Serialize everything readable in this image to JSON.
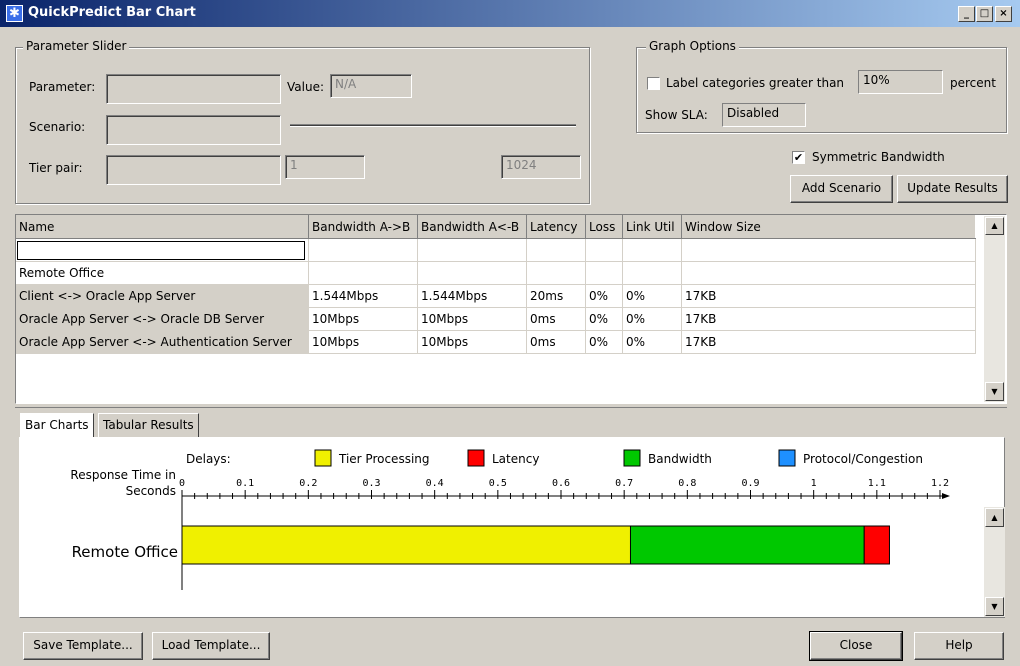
{
  "window": {
    "title": "QuickPredict Bar Chart"
  },
  "parameter_slider": {
    "legend": "Parameter Slider",
    "parameter_label": "Parameter:",
    "value_label": "Value:",
    "value": "N/A",
    "scenario_label": "Scenario:",
    "tier_pair_label": "Tier pair:",
    "range_min": "1",
    "range_max": "1024"
  },
  "graph_options": {
    "legend": "Graph Options",
    "label_categories_text": "Label categories greater than",
    "label_threshold": "10%",
    "percent_text": "percent",
    "show_sla_label": "Show SLA:",
    "show_sla_value": "Disabled"
  },
  "symmetric_bandwidth": {
    "label": "Symmetric Bandwidth",
    "checked": true
  },
  "buttons": {
    "add_scenario": "Add Scenario",
    "update_results": "Update Results",
    "save_template": "Save Template...",
    "load_template": "Load Template...",
    "close": "Close",
    "help": "Help"
  },
  "table": {
    "columns": [
      "Name",
      "Bandwidth A->B",
      "Bandwidth A<-B",
      "Latency",
      "Loss",
      "Link Util",
      "Window Size"
    ],
    "group_label": "Remote Office",
    "rows": [
      [
        "Client <-> Oracle App Server",
        "1.544Mbps",
        "1.544Mbps",
        "20ms",
        "0%",
        "0%",
        "17KB"
      ],
      [
        "Oracle App Server <-> Oracle DB Server",
        "10Mbps",
        "10Mbps",
        "0ms",
        "0%",
        "0%",
        "17KB"
      ],
      [
        "Oracle App Server <-> Authentication Server",
        "10Mbps",
        "10Mbps",
        "0ms",
        "0%",
        "0%",
        "17KB"
      ]
    ]
  },
  "tabs": [
    "Bar Charts",
    "Tabular Results"
  ],
  "chart_data": {
    "type": "bar",
    "orientation": "horizontal-stacked",
    "legend_title": "Delays:",
    "ylabel": "Response Time in Seconds",
    "categories": [
      "Remote Office"
    ],
    "xlim": [
      0,
      1.2
    ],
    "ticks": [
      "0",
      "0.1",
      "0.2",
      "0.3",
      "0.4",
      "0.5",
      "0.6",
      "0.7",
      "0.8",
      "0.9",
      "1",
      "1.1",
      "1.2"
    ],
    "series": [
      {
        "name": "Tier Processing",
        "color": "#f0f000",
        "values": [
          0.71
        ]
      },
      {
        "name": "Latency",
        "color": "#ff0000",
        "values": [
          0.04
        ]
      },
      {
        "name": "Bandwidth",
        "color": "#00c800",
        "values": [
          0.37
        ]
      },
      {
        "name": "Protocol/Congestion",
        "color": "#1e90ff",
        "values": [
          0
        ]
      }
    ],
    "stack_order": [
      "Tier Processing",
      "Bandwidth",
      "Latency"
    ]
  }
}
